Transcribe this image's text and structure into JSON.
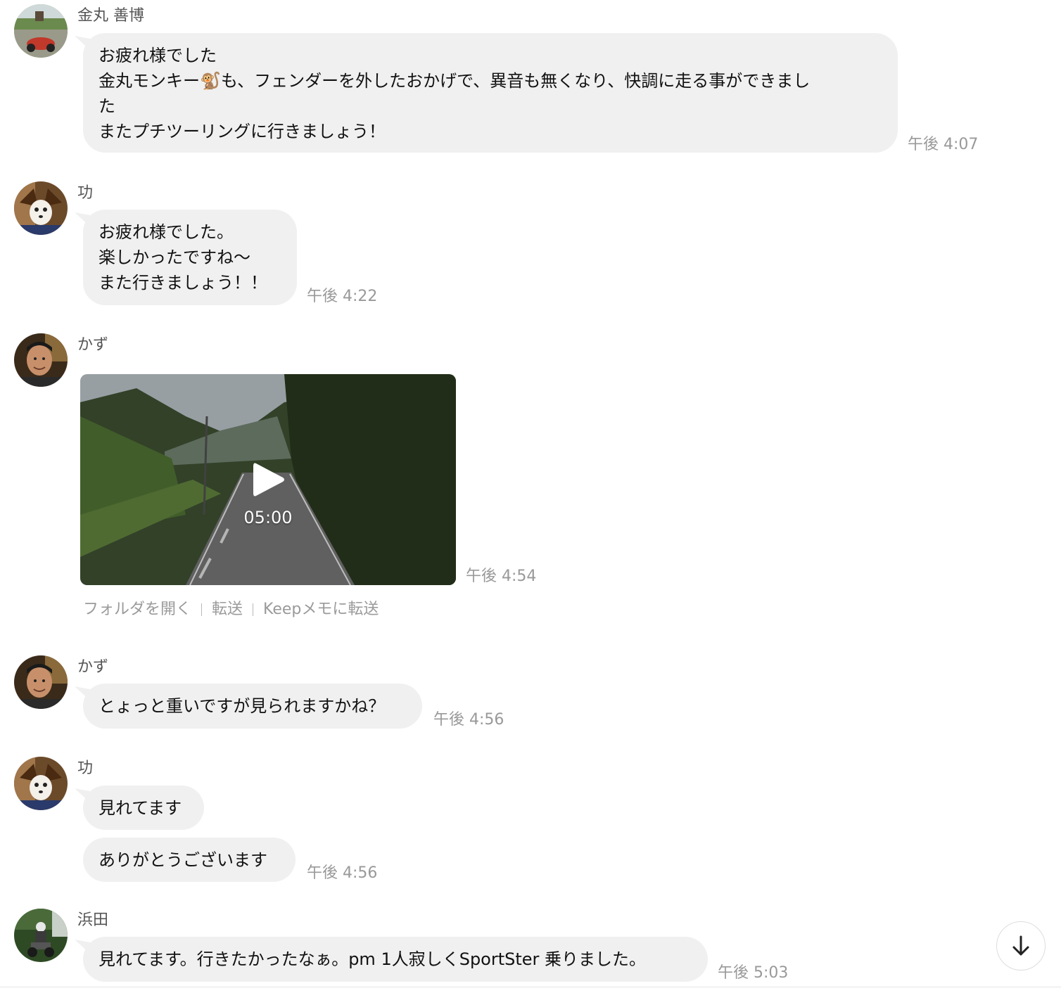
{
  "messages": [
    {
      "sender": "金丸 善博",
      "lines": [
        "お疲れ様でした",
        "金丸モンキー🐒も、フェンダーを外したおかげで、異音も無くなり、快調に走る事ができまし",
        "た",
        "またプチツーリングに行きましょう！"
      ],
      "time": "午後 4:07"
    },
    {
      "sender": "功",
      "lines": [
        "お疲れ様でした。",
        "楽しかったですね〜",
        "また行きましょう！！"
      ],
      "time": "午後 4:22"
    },
    {
      "sender": "かず",
      "video": {
        "duration": "05:00",
        "actions": [
          "フォルダを開く",
          "転送",
          "Keepメモに転送"
        ]
      },
      "time": "午後 4:54"
    },
    {
      "sender": "かず",
      "lines": [
        "とょっと重いですが見られますかね？"
      ],
      "time": "午後 4:56"
    },
    {
      "sender": "功",
      "bubbles": [
        "見れてます",
        "ありがとうございます"
      ],
      "time": "午後 4:56"
    },
    {
      "sender": "浜田",
      "lines": [
        "見れてます。行きたかったなぁ。pm 1人寂しくSportSter 乗りました。"
      ],
      "time": "午後 5:03"
    }
  ],
  "icons": {
    "scroll_down": "arrow-down-icon",
    "video_play": "play-icon"
  },
  "colors": {
    "bubble": "#f0f0f0",
    "timestamp": "#999999",
    "sender": "#555555"
  }
}
